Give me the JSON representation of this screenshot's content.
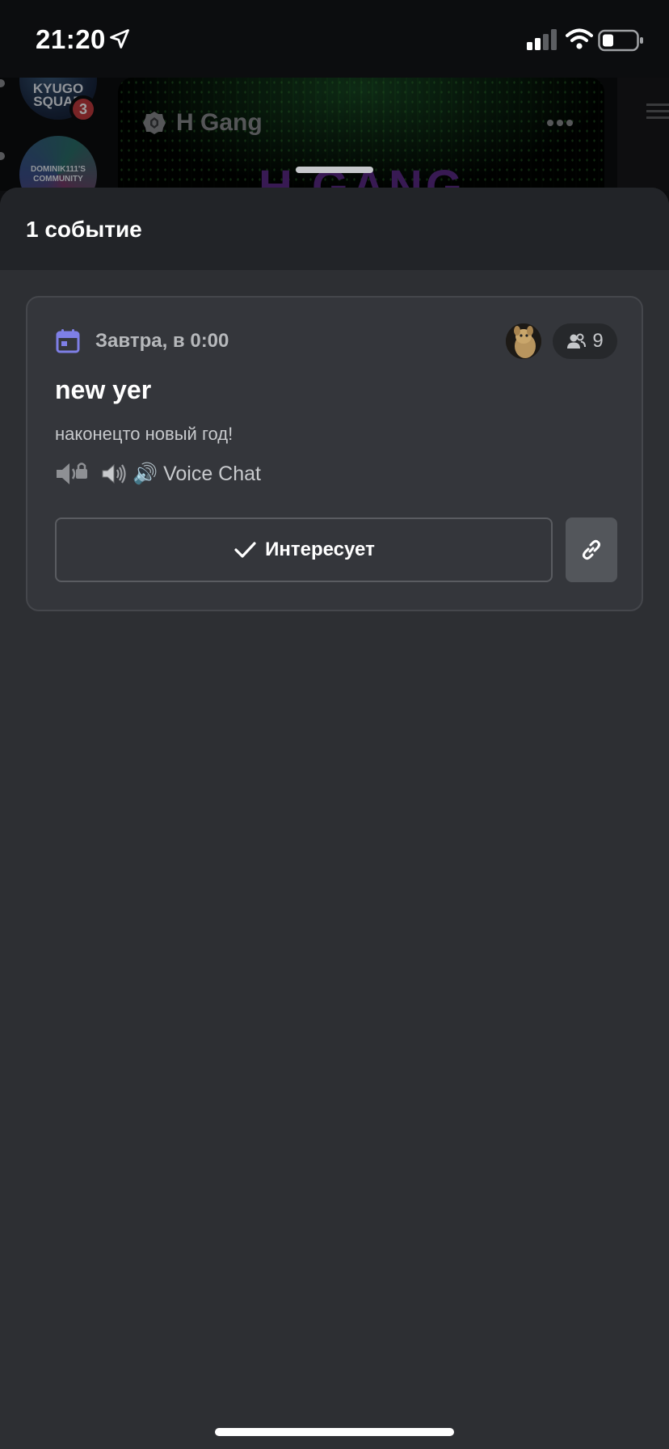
{
  "status_bar": {
    "time": "21:20"
  },
  "background": {
    "servers": [
      {
        "label": "KYUGO SQUAD",
        "mention_count": "3"
      },
      {
        "label": "DOMINIK111'S COMMUNITY"
      }
    ],
    "banner_logo": "H GANG",
    "server_name": "H Gang"
  },
  "sheet": {
    "title": "1 событие"
  },
  "event": {
    "time": "Завтра, в 0:00",
    "interested_count": "9",
    "name": "new yer",
    "description": "наконецто новый год!",
    "channel_name": "🔊 Voice Chat",
    "interested_button_label": "Интересует"
  },
  "colors": {
    "accent_calendar": "#7e7fe6",
    "sheet_bg": "#2d2f33",
    "header_bg": "#222428",
    "card_bg": "#34363b",
    "mention_badge": "#c23a3e"
  },
  "icons": [
    "location-arrow-icon",
    "signal-icon",
    "wifi-icon",
    "battery-icon",
    "boost-icon",
    "more-icon",
    "hamburger-icon",
    "calendar-icon",
    "users-icon",
    "locked-speaker-icon",
    "speaker-icon",
    "check-icon",
    "link-icon"
  ]
}
